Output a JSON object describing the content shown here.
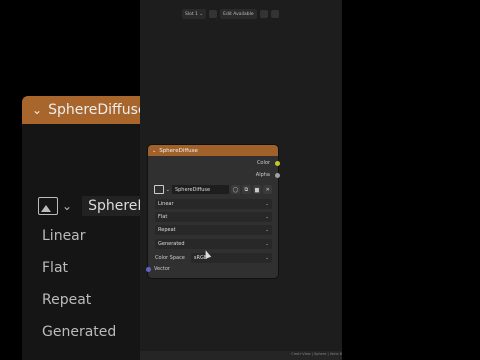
{
  "background_node": {
    "title": "SphereDiffuse",
    "image_name": "SphereD",
    "rows": [
      "Linear",
      "Flat",
      "Repeat",
      "Generated"
    ]
  },
  "toolbar": {
    "slot_label": "Slot 1",
    "mode_label": "Edit Available"
  },
  "node": {
    "title": "SphereDiffuse",
    "outputs": {
      "color": "Color",
      "alpha": "Alpha"
    },
    "image_name": "SphereDiffuse",
    "interpolation": "Linear",
    "projection": "Flat",
    "extension": "Repeat",
    "source": "Generated",
    "color_space_label": "Color Space",
    "color_space_value": "sRGB",
    "input_vector": "Vector"
  },
  "status_bar": {
    "text": "Cmd+View | Sphere | Verts 8"
  },
  "colors": {
    "header_orange": "#a0612b",
    "socket_yellow": "#c7c729",
    "socket_gray": "#a1a1a1",
    "socket_purple": "#6363c7"
  }
}
